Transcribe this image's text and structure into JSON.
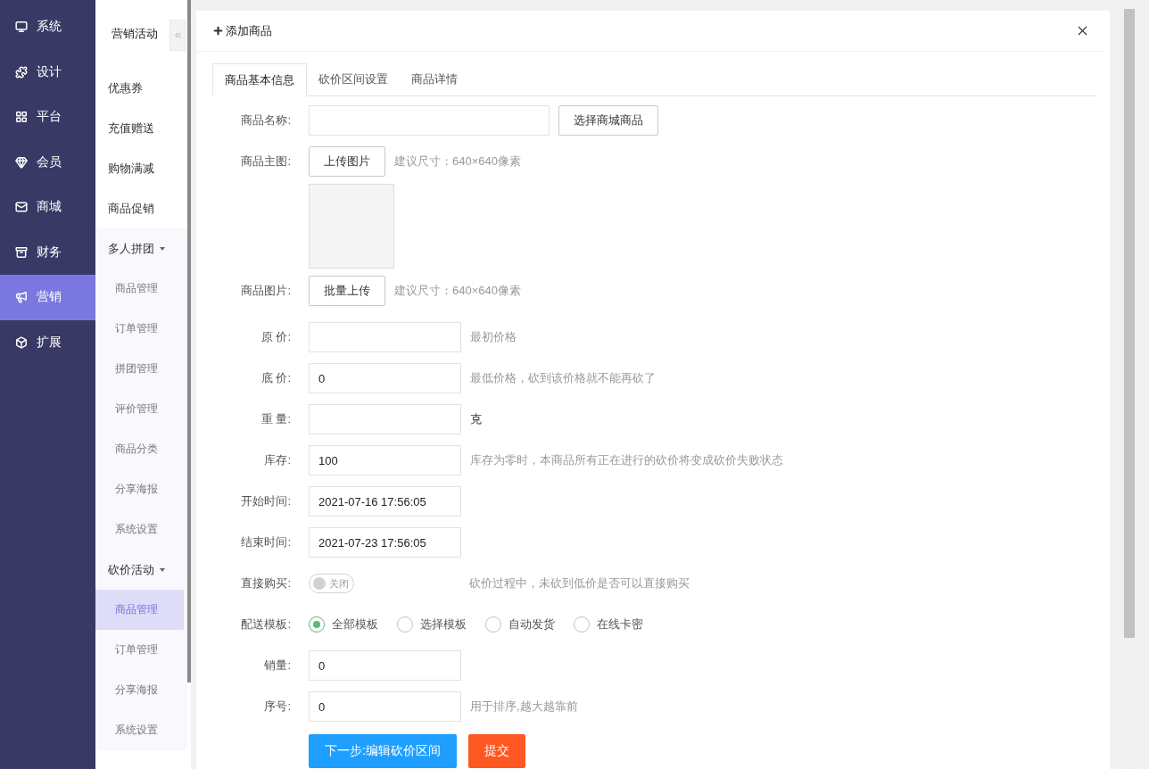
{
  "nav": [
    {
      "label": "系统",
      "selected": false
    },
    {
      "label": "设计",
      "selected": false
    },
    {
      "label": "平台",
      "selected": false
    },
    {
      "label": "会员",
      "selected": false
    },
    {
      "label": "商城",
      "selected": false
    },
    {
      "label": "财务",
      "selected": false
    },
    {
      "label": "营销",
      "selected": true
    },
    {
      "label": "扩展",
      "selected": false
    }
  ],
  "subnav": {
    "title": "营销活动",
    "items": [
      {
        "label": "优惠券",
        "selected": false
      },
      {
        "label": "充值赠送",
        "selected": false
      },
      {
        "label": "购物满减",
        "selected": false
      },
      {
        "label": "商品促销",
        "selected": false
      },
      {
        "label": "多人拼团",
        "expanded": true,
        "children": [
          {
            "label": "商品管理",
            "selected": false
          },
          {
            "label": "订单管理",
            "selected": false
          },
          {
            "label": "拼团管理",
            "selected": false
          },
          {
            "label": "评价管理",
            "selected": false
          },
          {
            "label": "商品分类",
            "selected": false
          },
          {
            "label": "分享海报",
            "selected": false
          },
          {
            "label": "系统设置",
            "selected": false
          }
        ]
      },
      {
        "label": "砍价活动",
        "expanded": true,
        "children": [
          {
            "label": "商品管理",
            "selected": true
          },
          {
            "label": "订单管理",
            "selected": false
          },
          {
            "label": "分享海报",
            "selected": false
          },
          {
            "label": "系统设置",
            "selected": false
          }
        ]
      }
    ]
  },
  "dialog": {
    "title": "添加商品",
    "tabs": [
      {
        "label": "商品基本信息",
        "selected": true
      },
      {
        "label": "砍价区间设置",
        "selected": false
      },
      {
        "label": "商品详情",
        "selected": false
      }
    ],
    "form": [
      {
        "kind": "text",
        "label": "商品名称:",
        "wide": true,
        "button": "选择商城商品"
      },
      {
        "kind": "upload",
        "label": "商品主图:",
        "button": "上传图片",
        "hint": "建议尺寸：640×640像素",
        "preview": true
      },
      {
        "kind": "upload",
        "label": "商品图片:",
        "button": "批量上传",
        "hint": "建议尺寸：640×640像素",
        "preview": false
      },
      {
        "kind": "text",
        "label": "原 价:",
        "hint": "最初价格"
      },
      {
        "kind": "text",
        "label": "底 价:",
        "value": "0",
        "hint": "最低价格，砍到该价格就不能再砍了"
      },
      {
        "kind": "text",
        "label": "重 量:",
        "unit": "克"
      },
      {
        "kind": "text",
        "label": "库存:",
        "value": "100",
        "hint": "库存为零时，本商品所有正在进行的砍价将变成砍价失败状态"
      },
      {
        "kind": "text",
        "label": "开始时间:",
        "value": "2021-07-16 17:56:05"
      },
      {
        "kind": "text",
        "label": "结束时间:",
        "value": "2021-07-23 17:56:05"
      },
      {
        "kind": "switch",
        "label": "直接购买:",
        "on": false,
        "text": "关闭",
        "hint": "砍价过程中，未砍到低价是否可以直接购买"
      },
      {
        "kind": "radio",
        "label": "配送模板:",
        "options": [
          {
            "label": "全部模板",
            "selected": true
          },
          {
            "label": "选择模板",
            "selected": false
          },
          {
            "label": "自动发货",
            "selected": false
          },
          {
            "label": "在线卡密",
            "selected": false
          }
        ]
      },
      {
        "kind": "text",
        "label": "销量:",
        "value": "0"
      },
      {
        "kind": "text",
        "label": "序号:",
        "value": "0",
        "hint": "用于排序,越大越靠前"
      }
    ],
    "actions": [
      {
        "label": "下一步:编辑砍价区间",
        "kind": "primary"
      },
      {
        "label": "提交",
        "kind": "danger"
      }
    ]
  }
}
